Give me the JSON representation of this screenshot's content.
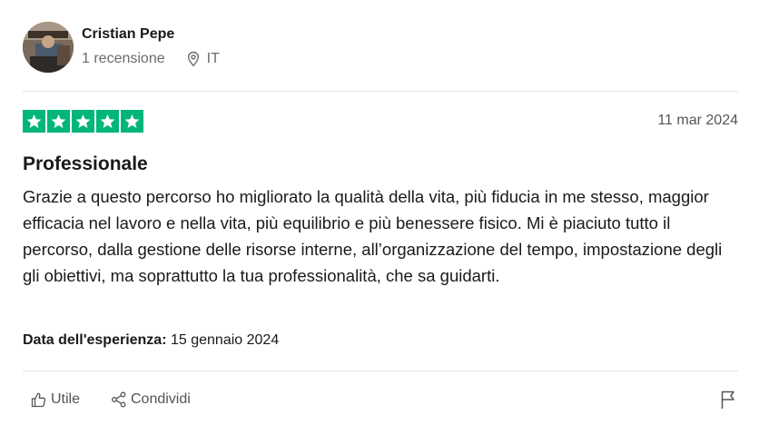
{
  "reviewer": {
    "name": "Cristian Pepe",
    "review_count": "1 recensione",
    "location": "IT",
    "avatar_icon": "avatar-photo"
  },
  "review": {
    "rating": 5,
    "rating_color": "#00b67a",
    "date": "11 mar 2024",
    "title": "Professionale",
    "body": "Grazie a questo percorso ho migliorato la qualità della vita, più fiducia in me stesso, maggior efficacia nel lavoro e nella vita, più equilibrio e più benessere fisico. Mi è piaciuto tutto il percorso, dalla gestione delle risorse interne, all’organizzazione del tempo, impostazione degli gli obiettivi, ma soprattutto la tua professionalità, che sa guidarti.",
    "experience_label": "Data dell'esperienza:",
    "experience_date": "15 gennaio 2024"
  },
  "actions": {
    "useful_label": "Utile",
    "useful_icon": "thumbs-up-icon",
    "share_label": "Condividi",
    "share_icon": "share-icon",
    "flag_icon": "flag-icon"
  }
}
